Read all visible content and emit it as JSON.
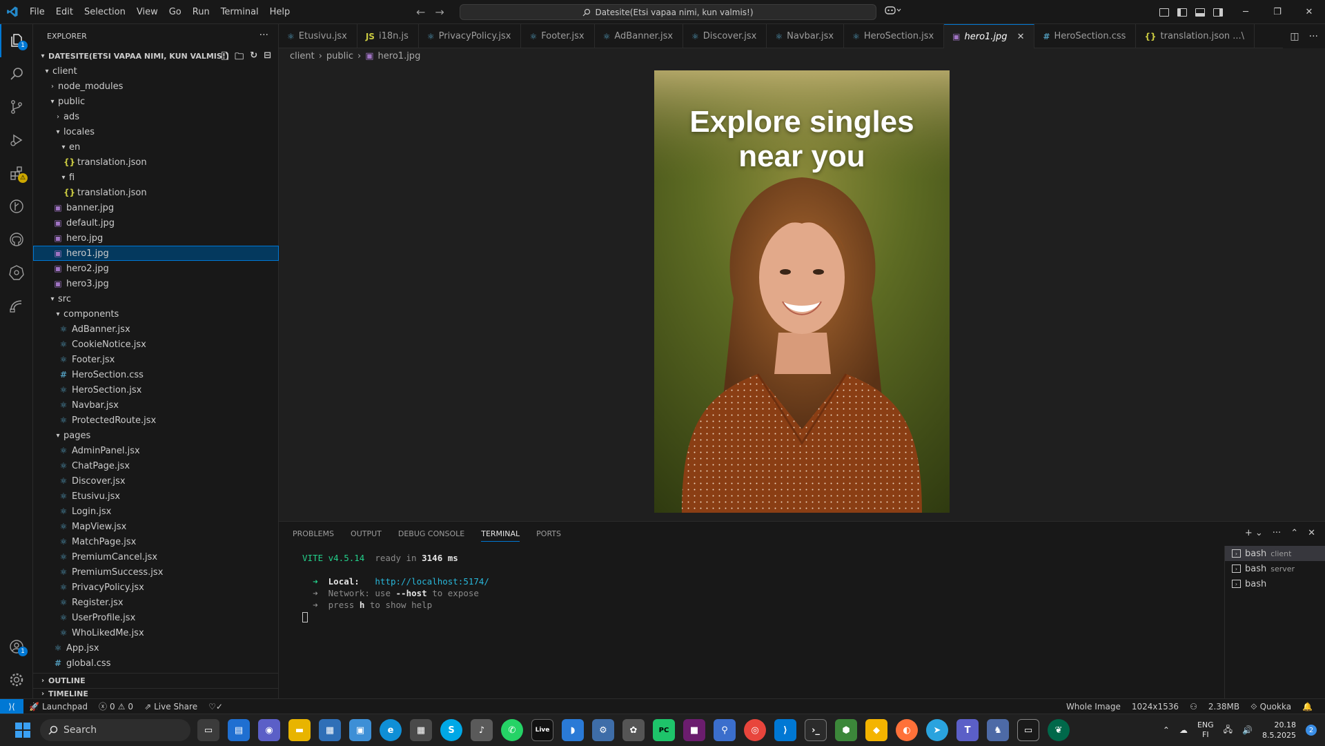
{
  "menu": [
    "File",
    "Edit",
    "Selection",
    "View",
    "Go",
    "Run",
    "Terminal",
    "Help"
  ],
  "command_center": "Datesite(Etsi vapaa nimi, kun valmis!)",
  "sidebar": {
    "title": "EXPLORER",
    "project": "DATESITE(ETSI VAPAA NIMI, KUN VALMIS!)",
    "tree": [
      {
        "label": "client",
        "depth": 0,
        "kind": "folder-open"
      },
      {
        "label": "node_modules",
        "depth": 1,
        "kind": "folder"
      },
      {
        "label": "public",
        "depth": 1,
        "kind": "folder-open"
      },
      {
        "label": "ads",
        "depth": 2,
        "kind": "folder"
      },
      {
        "label": "locales",
        "depth": 2,
        "kind": "folder-open"
      },
      {
        "label": "en",
        "depth": 3,
        "kind": "folder-open"
      },
      {
        "label": "translation.json",
        "depth": 4,
        "kind": "json"
      },
      {
        "label": "fi",
        "depth": 3,
        "kind": "folder-open"
      },
      {
        "label": "translation.json",
        "depth": 4,
        "kind": "json"
      },
      {
        "label": "banner.jpg",
        "depth": 2,
        "kind": "img"
      },
      {
        "label": "default.jpg",
        "depth": 2,
        "kind": "img"
      },
      {
        "label": "hero.jpg",
        "depth": 2,
        "kind": "img"
      },
      {
        "label": "hero1.jpg",
        "depth": 2,
        "kind": "img",
        "selected": true
      },
      {
        "label": "hero2.jpg",
        "depth": 2,
        "kind": "img"
      },
      {
        "label": "hero3.jpg",
        "depth": 2,
        "kind": "img"
      },
      {
        "label": "src",
        "depth": 1,
        "kind": "folder-open"
      },
      {
        "label": "components",
        "depth": 2,
        "kind": "folder-open"
      },
      {
        "label": "AdBanner.jsx",
        "depth": 3,
        "kind": "react"
      },
      {
        "label": "CookieNotice.jsx",
        "depth": 3,
        "kind": "react"
      },
      {
        "label": "Footer.jsx",
        "depth": 3,
        "kind": "react"
      },
      {
        "label": "HeroSection.css",
        "depth": 3,
        "kind": "css"
      },
      {
        "label": "HeroSection.jsx",
        "depth": 3,
        "kind": "react"
      },
      {
        "label": "Navbar.jsx",
        "depth": 3,
        "kind": "react"
      },
      {
        "label": "ProtectedRoute.jsx",
        "depth": 3,
        "kind": "react"
      },
      {
        "label": "pages",
        "depth": 2,
        "kind": "folder-open"
      },
      {
        "label": "AdminPanel.jsx",
        "depth": 3,
        "kind": "react"
      },
      {
        "label": "ChatPage.jsx",
        "depth": 3,
        "kind": "react"
      },
      {
        "label": "Discover.jsx",
        "depth": 3,
        "kind": "react"
      },
      {
        "label": "Etusivu.jsx",
        "depth": 3,
        "kind": "react"
      },
      {
        "label": "Login.jsx",
        "depth": 3,
        "kind": "react"
      },
      {
        "label": "MapView.jsx",
        "depth": 3,
        "kind": "react"
      },
      {
        "label": "MatchPage.jsx",
        "depth": 3,
        "kind": "react"
      },
      {
        "label": "PremiumCancel.jsx",
        "depth": 3,
        "kind": "react"
      },
      {
        "label": "PremiumSuccess.jsx",
        "depth": 3,
        "kind": "react"
      },
      {
        "label": "PrivacyPolicy.jsx",
        "depth": 3,
        "kind": "react"
      },
      {
        "label": "Register.jsx",
        "depth": 3,
        "kind": "react"
      },
      {
        "label": "UserProfile.jsx",
        "depth": 3,
        "kind": "react"
      },
      {
        "label": "WhoLikedMe.jsx",
        "depth": 3,
        "kind": "react"
      },
      {
        "label": "App.jsx",
        "depth": 2,
        "kind": "react"
      },
      {
        "label": "global.css",
        "depth": 2,
        "kind": "css"
      }
    ],
    "outline": "OUTLINE",
    "timeline": "TIMELINE"
  },
  "tabs": [
    {
      "label": "Etusivu.jsx",
      "icon": "react"
    },
    {
      "label": "i18n.js",
      "icon": "js"
    },
    {
      "label": "PrivacyPolicy.jsx",
      "icon": "react"
    },
    {
      "label": "Footer.jsx",
      "icon": "react"
    },
    {
      "label": "AdBanner.jsx",
      "icon": "react"
    },
    {
      "label": "Discover.jsx",
      "icon": "react"
    },
    {
      "label": "Navbar.jsx",
      "icon": "react"
    },
    {
      "label": "HeroSection.jsx",
      "icon": "react"
    },
    {
      "label": "hero1.jpg",
      "icon": "img",
      "active": true
    },
    {
      "label": "HeroSection.css",
      "icon": "css"
    },
    {
      "label": "translation.json ...\\",
      "icon": "json"
    }
  ],
  "breadcrumb": [
    "client",
    "public",
    "hero1.jpg"
  ],
  "image": {
    "headline": "Explore singles near you"
  },
  "panel": {
    "tabs": [
      "PROBLEMS",
      "OUTPUT",
      "DEBUG CONSOLE",
      "TERMINAL",
      "PORTS"
    ],
    "active_tab": "TERMINAL",
    "terminal": {
      "vite": "VITE v4.5.14",
      "ready": "ready in",
      "ms": "3146 ms",
      "arrow": "➜",
      "local_label": "Local:",
      "local_url": "http://localhost:5174/",
      "network_label": "Network:",
      "network_use": "use",
      "network_host": "--host",
      "network_rest": "to expose",
      "press": "press",
      "press_key": "h",
      "press_rest": "to show help"
    },
    "terminals": [
      {
        "name": "bash",
        "sub": "client",
        "active": true
      },
      {
        "name": "bash",
        "sub": "server"
      },
      {
        "name": "bash",
        "sub": ""
      }
    ]
  },
  "status": {
    "launchpad": "Launchpad",
    "errors": "0",
    "warnings": "0",
    "liveshare": "Live Share",
    "whole_image": "Whole Image",
    "dimensions": "1024x1536",
    "size": "2.38MB",
    "quokka": "Quokka"
  },
  "taskbar": {
    "search": "Search",
    "lang_top": "ENG",
    "lang_bottom": "FI",
    "time": "20.18",
    "date": "8.5.2025",
    "notifications": "2"
  },
  "colors": {
    "accent": "#0078d4",
    "selection": "#04395e"
  }
}
